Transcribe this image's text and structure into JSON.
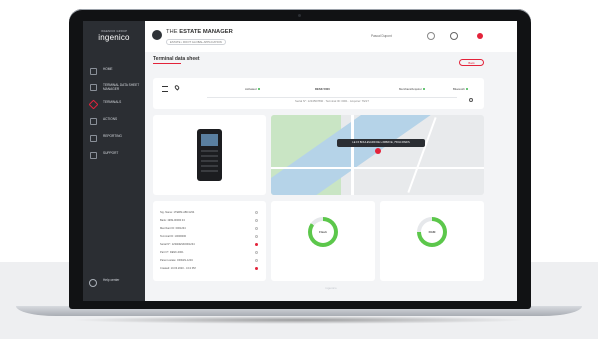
{
  "brand": {
    "name": "ingenico",
    "tagline": "INGENICO GROUP"
  },
  "sidebar": {
    "items": [
      {
        "label": "Home",
        "icon": "home-icon",
        "active": false
      },
      {
        "label": "Terminal data sheet manager",
        "icon": "document-icon",
        "active": false
      },
      {
        "label": "Terminals",
        "icon": "terminal-icon",
        "active": true
      },
      {
        "label": "Actions",
        "icon": "actions-icon",
        "active": false
      },
      {
        "label": "Reporting",
        "icon": "chart-icon",
        "active": false
      },
      {
        "label": "Support",
        "icon": "support-icon",
        "active": false
      }
    ],
    "help": {
      "label": "Help center",
      "icon": "help-icon"
    }
  },
  "header": {
    "title_prefix": "THE",
    "title_main": "ESTATE MANAGER",
    "subtitle": "ESTATE • ROOT GLOBAL APPLICATION",
    "user_name": "Pascal Dupont"
  },
  "page": {
    "title": "Terminal data sheet",
    "back_label": "Back"
  },
  "info_bar": {
    "status_label": "Activated",
    "model": "DESK 5000",
    "merchant_label": "Merchant/Acquirer",
    "region_label": "Bluetooth",
    "search_text": "Serial N°: 1234567890 · Terminal ID: 0001 · Acquirer: TEST"
  },
  "map": {
    "tooltip": "LE 15 BOULEVARD DE L'ABBAYE, 75014 PARIS"
  },
  "details": [
    {
      "label": "Sig. Name: 1TERM-ABC1234",
      "status": "ok"
    },
    {
      "label": "Bank: 1999-00000 43",
      "status": "ok"
    },
    {
      "label": "Merchant ID: 0001234",
      "status": "ok"
    },
    {
      "label": "Terminal ID: 10000000",
      "status": "ok"
    },
    {
      "label": "Serial N°: 1234DESK0001234",
      "status": "warn"
    },
    {
      "label": "Part N°: DESK-0001",
      "status": "ok"
    },
    {
      "label": "Parent estate: ORIGIN-1234",
      "status": "ok"
    },
    {
      "label": "Created: 10.03.2020 - 4:13 PM",
      "status": "warn"
    }
  ],
  "gauges": [
    {
      "label": "Flash",
      "value": 0.85,
      "color": "#5cc74b"
    },
    {
      "label": "RAM",
      "value": 0.75,
      "color": "#5cc74b"
    }
  ],
  "footer": "ingenico",
  "colors": {
    "accent": "#e3233a",
    "sidebar": "#2b2e33",
    "ok": "#38b44a"
  }
}
